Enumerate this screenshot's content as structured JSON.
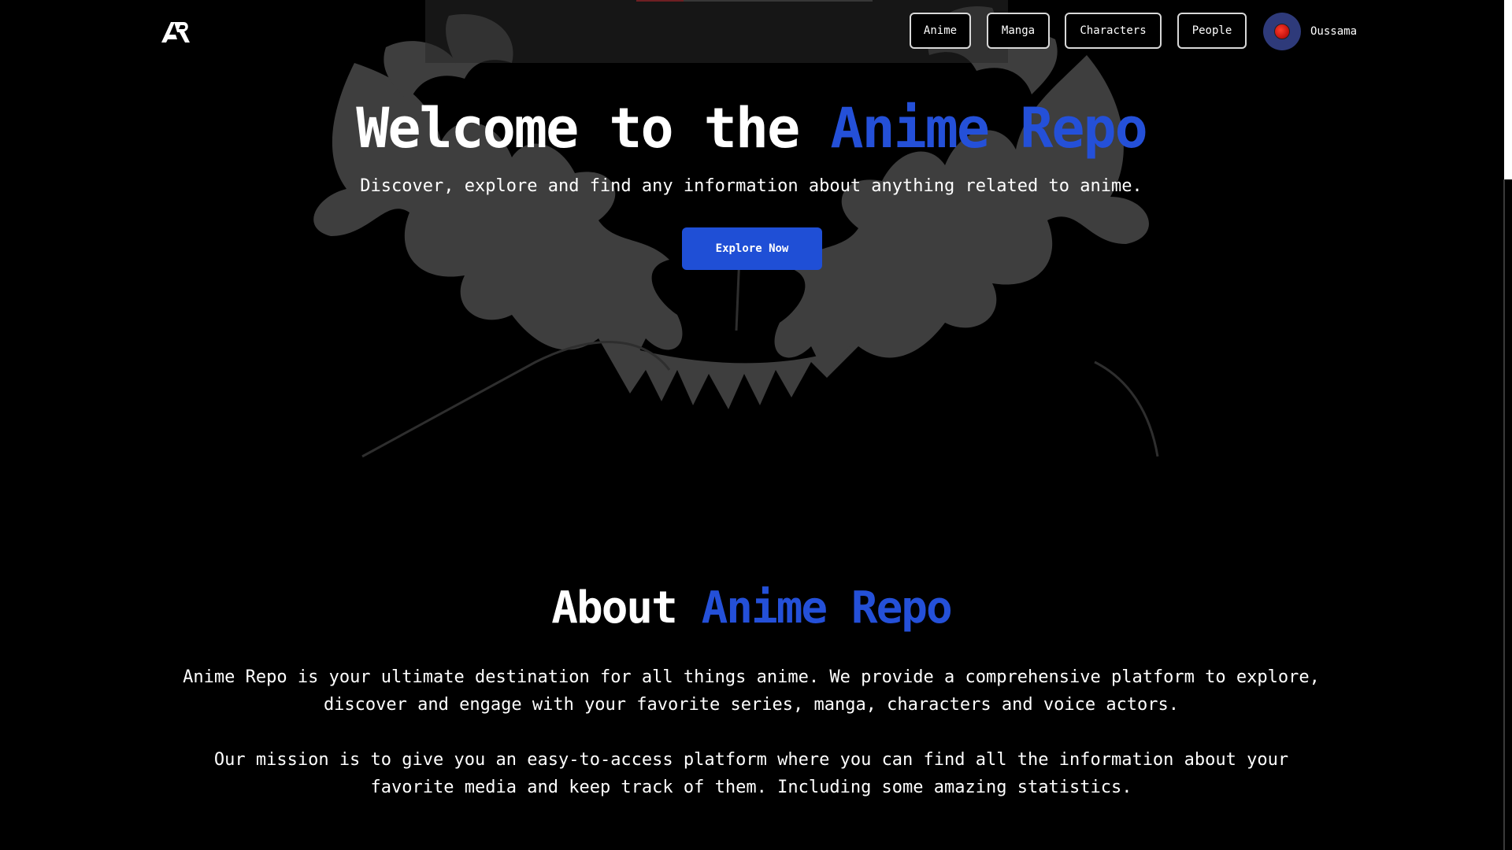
{
  "brand": {
    "logo_text": "AR"
  },
  "nav": {
    "items": [
      {
        "label": "Anime"
      },
      {
        "label": "Manga"
      },
      {
        "label": "Characters"
      },
      {
        "label": "People"
      }
    ],
    "user": {
      "name": "Oussama"
    }
  },
  "hero": {
    "title_part1": "Welcome to the ",
    "title_accent": "Anime Repo",
    "subtitle": "Discover, explore and find any information about anything related to anime.",
    "cta_label": "Explore Now"
  },
  "about": {
    "title_part1": "About ",
    "title_accent": "Anime Repo",
    "paragraph1_line1": "Anime Repo is your ultimate destination for all things anime. We provide a comprehensive platform to explore,",
    "paragraph1_line2": "discover and engage with your favorite series, manga, characters and voice actors.",
    "paragraph2_line1": "Our mission is to give you an easy-to-access platform where you can find all the information about your",
    "paragraph2_line2": "favorite media and keep track of them. Including some amazing statistics."
  },
  "colors": {
    "accent": "#2450d8",
    "button": "#1f4fd6",
    "background": "#000000",
    "avatar_bg": "#2e3a7a"
  },
  "icons": [
    "logo-icon",
    "avatar-icon"
  ]
}
